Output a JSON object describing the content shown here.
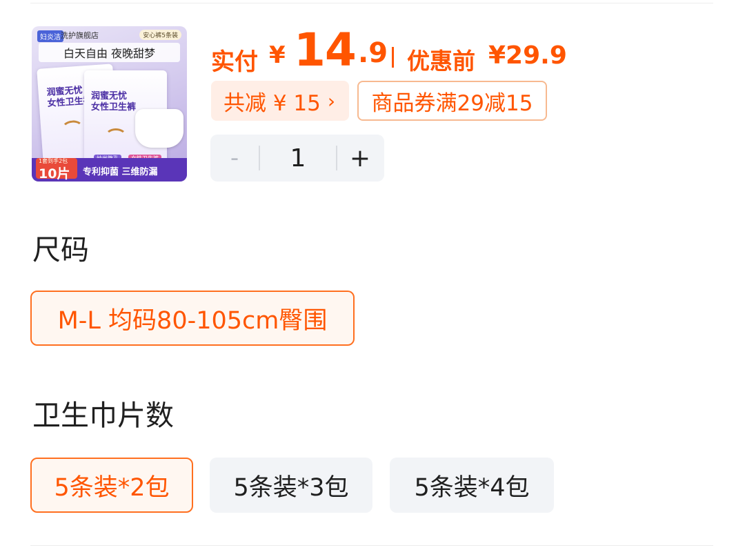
{
  "product": {
    "image": {
      "brand": "妇炎洁",
      "store": "洗护旗舰店",
      "badge": "安心裤5条装",
      "slogan": "白天自由  夜晚甜梦",
      "pack_text": "润蜜无忧\n女性卫生裤",
      "count_small": "1套到手2包",
      "count": "10片",
      "nano": "纳米微孔",
      "female": "女性卫生裤",
      "features": "专利抑菌  三维防漏"
    }
  },
  "price": {
    "paid_label": "实付",
    "currency": "¥",
    "price_int": "14",
    "price_dec": ".9",
    "before_label": "优惠前",
    "before_price": "¥29.9"
  },
  "discount": {
    "total_label": "共减 ¥ 15",
    "chevron": "›",
    "coupon_label": "商品券满29减15"
  },
  "stepper": {
    "minus": "-",
    "qty": "1",
    "plus": "+"
  },
  "size_section": {
    "title": "尺码",
    "options": [
      "M-L 均码80-105cm臀围"
    ],
    "selected": 0
  },
  "count_section": {
    "title": "卫生巾片数",
    "options": [
      "5条装*2包",
      "5条装*3包",
      "5条装*4包"
    ],
    "selected": 0
  },
  "colors": {
    "accent": "#ff5500",
    "selected_border": "#ff6f1f",
    "unselected_bg": "#f2f4f7"
  }
}
